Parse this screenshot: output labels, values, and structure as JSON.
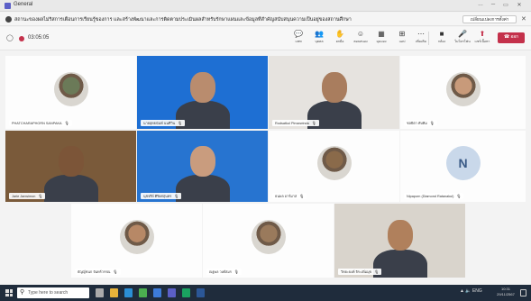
{
  "window": {
    "title": "General",
    "controls": [
      "…",
      "─",
      "▭",
      "✕"
    ]
  },
  "banner": {
    "text": "สถานะของผลไม่ริสการเตือนการเรียนรู้ของการ และสร้างพัฒนาและการติดตามประเมินผลสำหรับรักษาแผนและข้อมูลที่สำคัญสนับสนุนความเป็นอยู่ของสถานศึกษา",
    "button_label": "เปลี่ยนแปลงการตั้งค่า",
    "close_label": "✕"
  },
  "toolbar": {
    "timer": "03:05:05",
    "items": [
      {
        "icon": "chat-icon",
        "glyph": "💬",
        "label": "แชท"
      },
      {
        "icon": "people-icon",
        "glyph": "👥",
        "label": "บุคคล"
      },
      {
        "icon": "raise-hand-icon",
        "glyph": "✋",
        "label": "ยกมือ"
      },
      {
        "icon": "reactions-icon",
        "glyph": "☺",
        "label": "ตอบสนอง"
      },
      {
        "icon": "view-icon",
        "glyph": "▦",
        "label": "มุมมอง"
      },
      {
        "icon": "apps-icon",
        "glyph": "⊞",
        "label": "แอป"
      },
      {
        "icon": "more-icon",
        "glyph": "⋯",
        "label": "เพิ่มเติม"
      },
      {
        "icon": "camera-icon",
        "glyph": "■",
        "label": "กล้อง"
      },
      {
        "icon": "mic-icon",
        "glyph": "🎤",
        "label": "ไมโครโฟน"
      },
      {
        "icon": "share-icon",
        "glyph": "⬆",
        "label": "แชร์เนื้อหา"
      }
    ],
    "leave_label": "ออก"
  },
  "participants": [
    {
      "name": "PHATCHARAPHORN SANPAKA",
      "type": "avatar",
      "bg": "#fdfdfd",
      "face": "#6b7a58"
    },
    {
      "name": "นายยุทธนันท์ นนทีวิน",
      "type": "video",
      "bg": "#1e6fd3",
      "face": "#b98c6e"
    },
    {
      "name": "Rodsatkul Pimarwinda",
      "type": "video",
      "bg": "#e6e3df",
      "face": "#a97d5e"
    },
    {
      "name": "ชลธิตา ทับทิม",
      "type": "avatar",
      "bg": "#fdfdfd",
      "face": "#c89a7a"
    },
    {
      "name": "Jarie Janwimon",
      "type": "video",
      "bg": "#7a5a3a",
      "face": "#7c5538"
    },
    {
      "name": "นุชจรีย์ ศิริยศสุนทร",
      "type": "video",
      "bg": "#2774d0",
      "face": "#c99c7e"
    },
    {
      "name": "ธนพล อาร์มาส",
      "type": "avatar",
      "bg": "#fdfdfd",
      "face": "#8a6a4a"
    },
    {
      "name": "Nipaporn (Diamond Ratanakul)",
      "type": "initials",
      "initials": "N",
      "bg": "#fdfdfd"
    },
    {
      "name": "ธัญญ์ชนก จันทร์วรรณ",
      "type": "avatar",
      "bg": "#fdfdfd",
      "face": "#b78866"
    },
    {
      "name": "ณฐพล วงศ์สมร",
      "type": "avatar",
      "bg": "#fdfdfd",
      "face": "#9a7a5c"
    },
    {
      "name": "วิทยะยงค์ จิระเพิ่มมุข",
      "type": "video",
      "bg": "#d9d4cc",
      "face": "#b0805c"
    }
  ],
  "taskbar": {
    "search_placeholder": "Type here to search",
    "apps": [
      "task-view",
      "files",
      "edge",
      "chrome",
      "store",
      "teams",
      "meet",
      "word"
    ],
    "tray": "▲ 🔈 ENG",
    "time": "10:31",
    "date": "29/11/2567"
  }
}
